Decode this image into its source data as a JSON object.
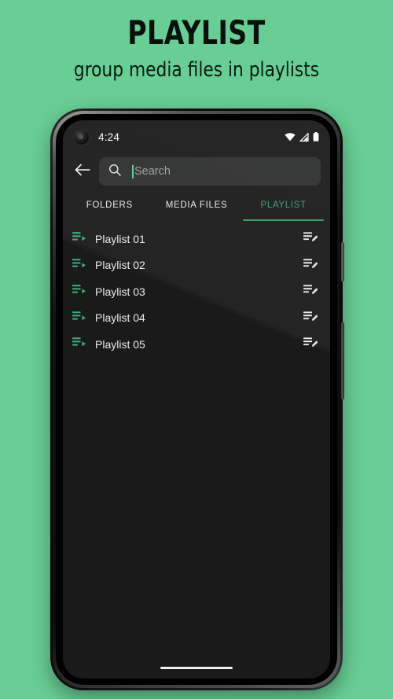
{
  "promo": {
    "title": "PLAYLIST",
    "subtitle": "group media files in playlists",
    "background_color": "#69ce95",
    "title_color": "#05110a"
  },
  "theme": {
    "accent_green": "#2e9e5f",
    "accent_green_light": "#4cb97c",
    "screen_background": "#1a1a1a",
    "search_field_background": "#2d2f2e",
    "text_primary": "#e9ebea",
    "text_placeholder": "#9aa09c"
  },
  "statusbar": {
    "time": "4:24",
    "icons": [
      "wifi-icon",
      "cellular-signal-icon",
      "battery-icon"
    ],
    "camera": "punch-hole-camera"
  },
  "appbar": {
    "back_icon": "back-arrow-icon",
    "search": {
      "icon": "search-icon",
      "value": "",
      "placeholder": "Search",
      "caret_visible": true
    }
  },
  "tabs": {
    "items": [
      {
        "label": "FOLDERS",
        "active": false
      },
      {
        "label": "MEDIA FILES",
        "active": false
      },
      {
        "label": "PLAYLIST",
        "active": true
      }
    ],
    "active_index": 2
  },
  "playlists": {
    "leading_icon": "playlist-play-icon",
    "trailing_icon": "playlist-edit-icon",
    "items": [
      {
        "name": "Playlist 01"
      },
      {
        "name": "Playlist 02"
      },
      {
        "name": "Playlist 03"
      },
      {
        "name": "Playlist 04"
      },
      {
        "name": "Playlist 05"
      }
    ]
  },
  "navigation": {
    "gesture_bar": "gesture-pill"
  },
  "device": {
    "buttons": [
      "power-button",
      "volume-rocker"
    ]
  }
}
